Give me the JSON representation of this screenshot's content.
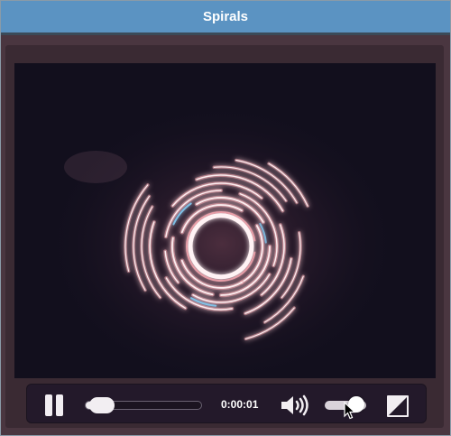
{
  "window": {
    "title": "Spirals"
  },
  "player": {
    "state": "playing",
    "progress_fraction": 0.03,
    "current_time": "0:00:01",
    "volume_fraction": 0.75
  },
  "icons": {
    "pause": "pause-icon",
    "volume": "speaker-volume-icon",
    "fullscreen": "fullscreen-icon",
    "cursor": "mouse-pointer-icon"
  },
  "colors": {
    "titlebar": "#5b93c2",
    "video_background": "#120f1d",
    "spiral_glow": "#f0a0aa",
    "spiral_core": "#fff2f4",
    "spiral_accent": "#7ec8f0"
  }
}
